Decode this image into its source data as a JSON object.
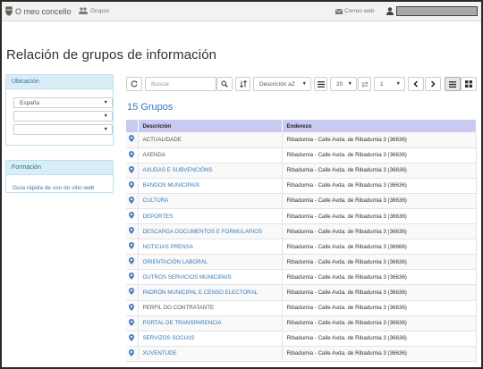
{
  "header": {
    "brand": "O meu concello",
    "groups_link": "Grupos",
    "mail_link": "Correo web",
    "user_name": ""
  },
  "page": {
    "title": "Relación de grupos de información"
  },
  "sidebar": {
    "location_title": "Ubicación",
    "location_selects": [
      "España",
      "",
      ""
    ],
    "formation_title": "Formación",
    "formation_link": "Guía rápida de uso do sitio web"
  },
  "toolbar": {
    "search_placeholder": "Buscar",
    "sort_value": "Descrición aZ",
    "page_size": "20",
    "page_number": "1"
  },
  "results": {
    "count_title": "15 Grupos"
  },
  "table": {
    "columns": [
      "Descrición",
      "Enderezo"
    ],
    "rows": [
      {
        "desc": "ACTUALIDADE",
        "addr": "Ribadumia - Calle Avda. de Ribadumia 3 (36636)",
        "link": false
      },
      {
        "desc": "AXENDA",
        "addr": "Ribadumia - Calle Avda. de Ribadumia 3 (36636)",
        "link": false
      },
      {
        "desc": "AXUDAS E SUBVENCIÓNS",
        "addr": "Ribadumia - Calle Avda. de Ribadumia 3 (36636)",
        "link": true
      },
      {
        "desc": "BANDOS MUNICIPAIS",
        "addr": "Ribadumia - Calle Avda. de Ribadumia 3 (36636)",
        "link": true
      },
      {
        "desc": "CULTURA",
        "addr": "Ribadumia - Calle Avda. de Ribadumia 3 (36636)",
        "link": true
      },
      {
        "desc": "DEPORTES",
        "addr": "Ribadumia - Calle Avda. de Ribadumia 3 (36636)",
        "link": true
      },
      {
        "desc": "DESCARGA DOCUMENTOS E FORMULARIOS",
        "addr": "Ribadumia - Calle Avda. de Ribadumia 3 (36636)",
        "link": true
      },
      {
        "desc": "NOTICIAS PRENSA",
        "addr": "Ribadumia - Calle Avda. de Ribadumia 3 (36666)",
        "link": true
      },
      {
        "desc": "ORIENTACIÓN LABORAL",
        "addr": "Ribadumia - Calle Avda. de Ribadumia 3 (36636)",
        "link": true
      },
      {
        "desc": "OUTROS SERVICIOS MUNICIPAIS",
        "addr": "Ribadumia - Calle Avda. de Ribadumia 3 (36636)",
        "link": true
      },
      {
        "desc": "PADRÓN MUNICIPAL E CENSO ELECTORAL",
        "addr": "Ribadumia - Calle Avda. de Ribadumia 3 (36636)",
        "link": true
      },
      {
        "desc": "PERFIL DO CONTRATANTE",
        "addr": "Ribadumia - Calle Avda. de Ribadumia 3 (36636)",
        "link": false
      },
      {
        "desc": "PORTAL DE TRANSPARENCIA",
        "addr": "Ribadumia - Calle Avda. de Ribadumia 3 (36636)",
        "link": true
      },
      {
        "desc": "SERVIZOS SOCIAIS",
        "addr": "Ribadumia - Calle Avda. de Ribadumia 3 (36636)",
        "link": true
      },
      {
        "desc": "XUVENTUDE",
        "addr": "Ribadumia - Calle Avda. de Ribadumia 3 (36636)",
        "link": true
      }
    ]
  },
  "colors": {
    "link": "#337ab7",
    "panel_header_bg": "#d9edf7",
    "table_header_bg": "#c9c9f2",
    "row_stripe": "#f9f9f9"
  },
  "icons": [
    "shield-logo-icon",
    "group-icon",
    "envelope-icon",
    "user-icon",
    "refresh-icon",
    "search-icon",
    "sort-icon",
    "list-icon",
    "exchange-icon",
    "chevron-left-icon",
    "chevron-right-icon",
    "list-view-icon",
    "grid-view-icon",
    "map-marker-icon"
  ]
}
